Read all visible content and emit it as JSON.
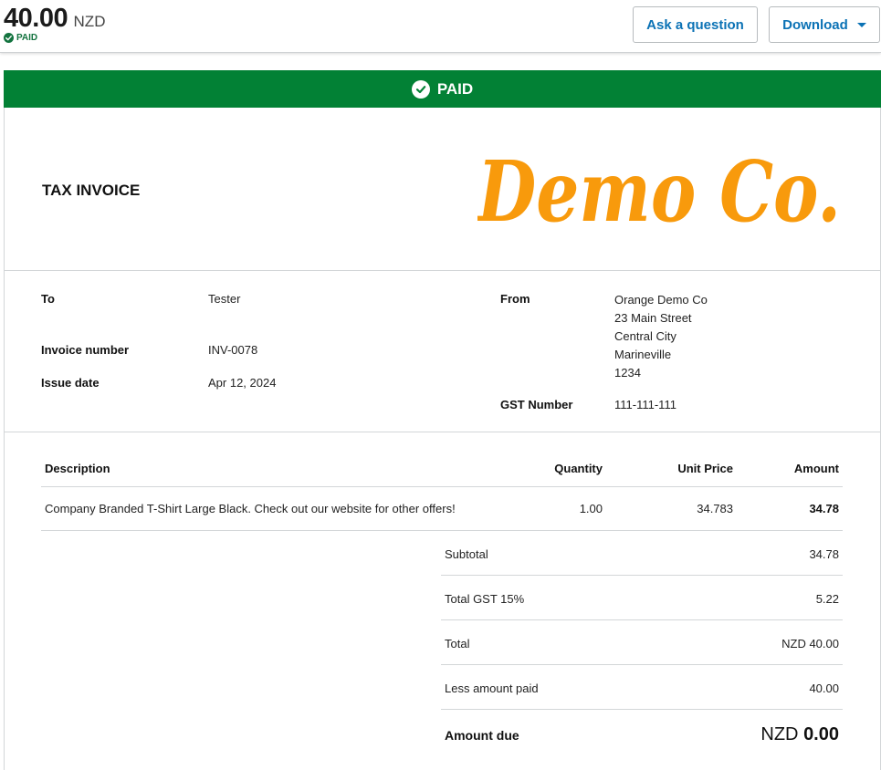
{
  "header": {
    "amount": "40.00",
    "currency": "NZD",
    "status": "PAID",
    "ask_button": "Ask a question",
    "download_button": "Download"
  },
  "banner": {
    "text": "PAID",
    "color": "#028135"
  },
  "invoice": {
    "title": "TAX INVOICE",
    "logo_text": "Demo Co.",
    "logo_color": "#f89a0c",
    "to_label": "To",
    "to_value": "Tester",
    "invoice_number_label": "Invoice number",
    "invoice_number": "INV-0078",
    "issue_date_label": "Issue date",
    "issue_date": "Apr 12, 2024",
    "from_label": "From",
    "from_address": [
      "Orange Demo Co",
      "23 Main Street",
      "Central City",
      "Marineville",
      "1234"
    ],
    "gst_label": "GST Number",
    "gst_number": "111-111-111"
  },
  "table": {
    "headers": {
      "description": "Description",
      "quantity": "Quantity",
      "unit_price": "Unit Price",
      "amount": "Amount"
    },
    "rows": [
      {
        "description": "Company Branded T-Shirt Large Black. Check out our website for other offers!",
        "quantity": "1.00",
        "unit_price": "34.783",
        "amount": "34.78"
      }
    ]
  },
  "summary": {
    "subtotal_label": "Subtotal",
    "subtotal": "34.78",
    "gst_label": "Total GST 15%",
    "gst": "5.22",
    "total_label": "Total",
    "total": "NZD 40.00",
    "paid_label": "Less amount paid",
    "paid": "40.00",
    "due_label": "Amount due",
    "due_currency": "NZD",
    "due_amount": "0.00"
  },
  "colors": {
    "accent_blue": "#0b72b5",
    "paid_green": "#13733f"
  }
}
